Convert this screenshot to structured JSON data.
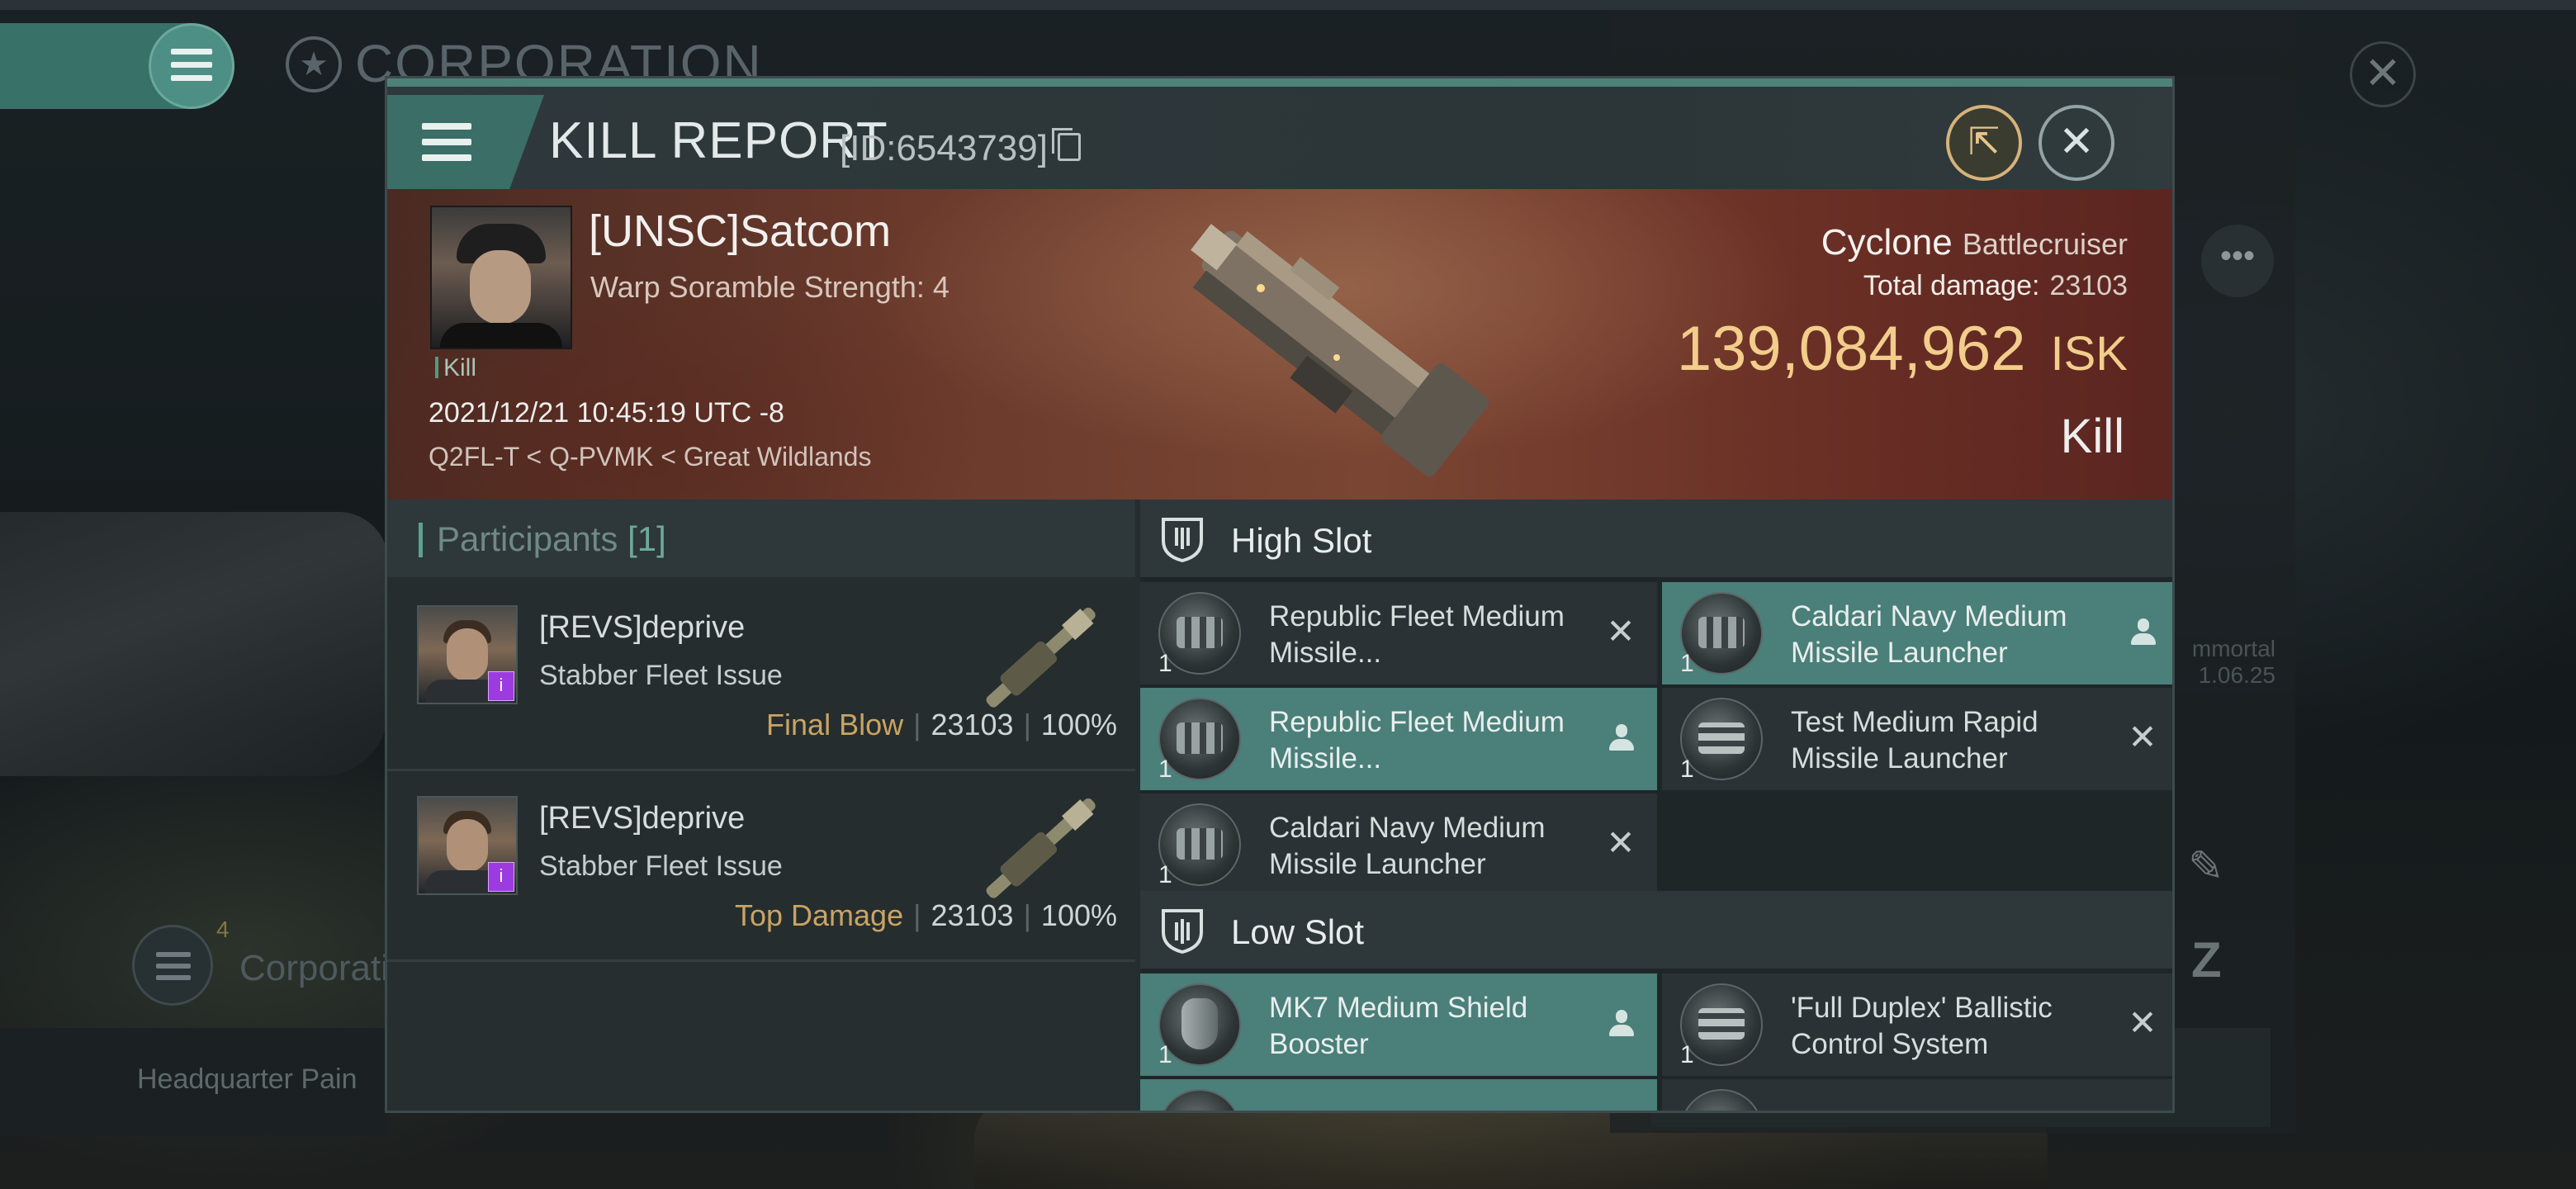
{
  "background": {
    "corp_title": "CORPORATION",
    "corp_badge_count": "4",
    "corp_label": "Corporatio",
    "hq_label": "Headquarter Pain",
    "immortal_text": "mmortal",
    "immortal_time": "1.06.25"
  },
  "kill_report": {
    "title": "KILL REPORT",
    "id_text": "[ID:6543739]",
    "victim": {
      "name": "[UNSC]Satcom",
      "warp_text": "Warp Soramble Strength: 4",
      "kill_tag": "Kill",
      "datetime": "2021/12/21 10:45:19 UTC -8",
      "location": "Q2FL-T < Q-PVMK < Great Wildlands"
    },
    "ship": {
      "name": "Cyclone",
      "class": "Battlecruiser",
      "total_damage_label": "Total damage:",
      "total_damage": "23103",
      "isk_value": "139,084,962",
      "isk_unit": "ISK",
      "result": "Kill"
    },
    "participants": {
      "label": "Participants",
      "count": "[1]",
      "rows": [
        {
          "name": "[REVS]deprive",
          "ship": "Stabber Fleet Issue",
          "role": "Final Blow",
          "damage": "23103",
          "percent": "100%"
        },
        {
          "name": "[REVS]deprive",
          "ship": "Stabber Fleet Issue",
          "role": "Top Damage",
          "damage": "23103",
          "percent": "100%"
        }
      ]
    },
    "high_slot": {
      "label": "High Slot",
      "items": [
        {
          "qty": "1",
          "name": "Republic Fleet Medium Missile...",
          "status": "destroyed"
        },
        {
          "qty": "1",
          "name": "Caldari Navy Medium Missile Launcher",
          "status": "dropped"
        },
        {
          "qty": "1",
          "name": "Republic Fleet Medium Missile...",
          "status": "dropped"
        },
        {
          "qty": "1",
          "name": "Test Medium Rapid Missile Launcher",
          "status": "destroyed"
        },
        {
          "qty": "1",
          "name": "Caldari Navy Medium Missile Launcher",
          "status": "destroyed"
        }
      ]
    },
    "low_slot": {
      "label": "Low Slot",
      "items": [
        {
          "qty": "1",
          "name": "MK7 Medium Shield Booster",
          "status": "dropped"
        },
        {
          "qty": "1",
          "name": "'Full Duplex' Ballistic Control System",
          "status": "destroyed"
        }
      ]
    }
  },
  "colors": {
    "accent_teal": "#4d8278",
    "isk_gold": "#f2cd8b",
    "role_gold": "#c9a463",
    "dropped_item_bg": "#4b7f79"
  },
  "icons": [
    "menu-icon",
    "corporation-star-icon",
    "external-share-icon",
    "close-icon",
    "copy-icon",
    "slot-shield-icon",
    "person-icon",
    "x-icon",
    "edit-icon"
  ]
}
